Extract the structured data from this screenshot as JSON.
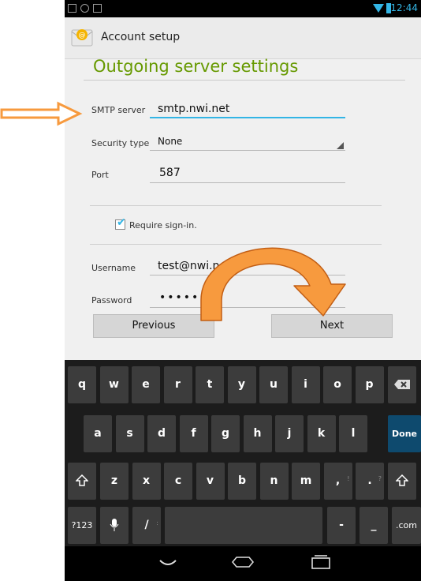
{
  "status_bar": {
    "time": "12:44"
  },
  "action_bar": {
    "title": "Account setup"
  },
  "page": {
    "heading": "Outgoing server settings"
  },
  "form": {
    "smtp_server": {
      "label": "SMTP server",
      "value": "smtp.nwi.net"
    },
    "security_type": {
      "label": "Security type",
      "value": "None"
    },
    "port": {
      "label": "Port",
      "value": "587"
    },
    "require_signin": {
      "label": "Require sign-in.",
      "checked": true
    },
    "username": {
      "label": "Username",
      "value": "test@nwi.n"
    },
    "password": {
      "label": "Password",
      "value": "•••••••"
    }
  },
  "buttons": {
    "previous": "Previous",
    "next": "Next"
  },
  "keyboard": {
    "row1": [
      {
        "k": "q"
      },
      {
        "k": "w"
      },
      {
        "k": "e"
      },
      {
        "k": "r"
      },
      {
        "k": "t"
      },
      {
        "k": "y"
      },
      {
        "k": "u"
      },
      {
        "k": "i"
      },
      {
        "k": "o"
      },
      {
        "k": "p"
      }
    ],
    "row2": [
      {
        "k": "a"
      },
      {
        "k": "s"
      },
      {
        "k": "d"
      },
      {
        "k": "f"
      },
      {
        "k": "g"
      },
      {
        "k": "h"
      },
      {
        "k": "j"
      },
      {
        "k": "k"
      },
      {
        "k": "l"
      }
    ],
    "row3": [
      {
        "k": "z"
      },
      {
        "k": "x"
      },
      {
        "k": "c"
      },
      {
        "k": "v"
      },
      {
        "k": "b"
      },
      {
        "k": "n"
      },
      {
        "k": "m"
      },
      {
        "k": ",",
        "alt": "!"
      },
      {
        "k": ".",
        "alt": "?"
      }
    ],
    "done": "Done",
    "symbols": "?123",
    "slash": "/",
    "slash_alt": ":",
    "dash": "-",
    "underscore": "_",
    "dotcom": ".com"
  },
  "colors": {
    "accent": "#33b5e5",
    "heading": "#669900",
    "annotation": "#f79a3e"
  },
  "icons": [
    "email-app-icon",
    "backspace-icon",
    "shift-icon",
    "mic-icon",
    "back-icon",
    "home-icon",
    "recent-apps-icon"
  ]
}
